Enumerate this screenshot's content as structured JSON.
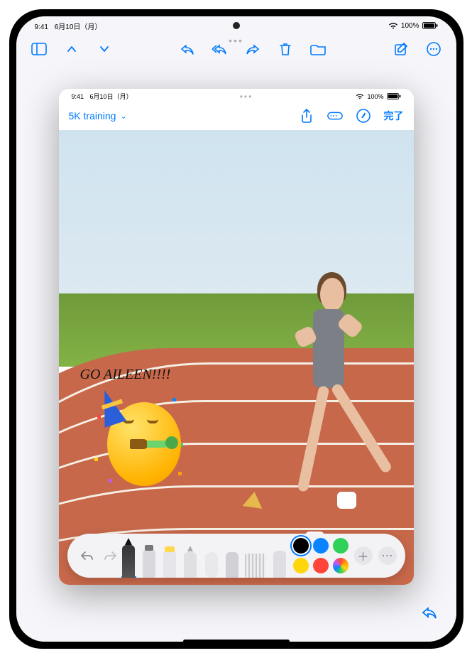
{
  "outer_status": {
    "time": "9:41",
    "date": "6月10日（月）",
    "battery_pct": "100%"
  },
  "outer_toolbar": {
    "sidebar_label": "サイドバー",
    "prev_label": "前へ",
    "next_label": "次へ",
    "reply_label": "返信",
    "reply_all_label": "全員に返信",
    "forward_label": "転送",
    "trash_label": "削除",
    "folder_label": "移動",
    "compose_label": "新規",
    "more_label": "その他"
  },
  "fg_status": {
    "time": "9:41",
    "date": "6月10日（月）",
    "battery_pct": "100%"
  },
  "fg_header": {
    "document_title": "5K training",
    "share_label": "共有",
    "autoshape_label": "自動シェイプ",
    "markup_label": "マークアップ",
    "done_label": "完了"
  },
  "canvas": {
    "annotation_text": "GO AILEEN!!!!",
    "emoji_name": "partying-face"
  },
  "palette": {
    "undo_label": "取り消す",
    "redo_label": "やり直す",
    "tools": {
      "pen": "ペン",
      "marker": "マーカー",
      "highlighter": "蛍光ペン",
      "pencil": "鉛筆",
      "eraser": "消しゴム",
      "lasso": "投げ縄",
      "ruler": "定規",
      "brush": "ブラシ"
    },
    "colors": {
      "black": "#000000",
      "blue": "#0a84ff",
      "green": "#30d158",
      "yellow": "#ffd60a",
      "red": "#ff453a",
      "multicolor_label": "カラーピッカー"
    },
    "add_label": "追加",
    "more_label": "その他"
  },
  "bg_reply_label": "返信"
}
